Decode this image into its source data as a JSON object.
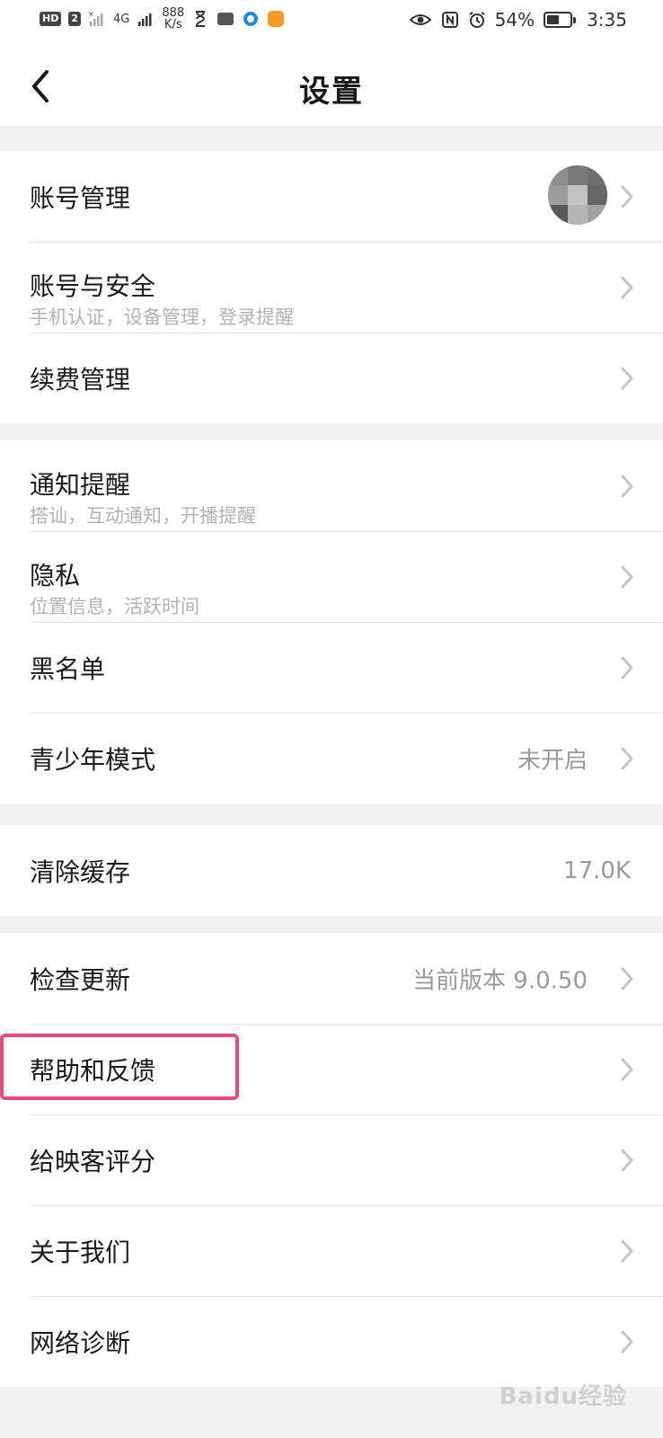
{
  "status_bar": {
    "hd_label": "HD",
    "sim_label": "2",
    "network_label": "4G",
    "speed_value": "888",
    "speed_unit": "K/s",
    "battery_percent": "54%",
    "battery_level": 0.54,
    "time": "3:35"
  },
  "header": {
    "title": "设置",
    "back_icon": "chevron-left-icon"
  },
  "groups": [
    {
      "rows": [
        {
          "title": "账号管理",
          "has_avatar": true
        },
        {
          "title": "账号与安全",
          "subtitle": "手机认证，设备管理，登录提醒"
        },
        {
          "title": "续费管理"
        }
      ]
    },
    {
      "rows": [
        {
          "title": "通知提醒",
          "subtitle": "搭讪，互动通知，开播提醒"
        },
        {
          "title": "隐私",
          "subtitle": "位置信息，活跃时间"
        },
        {
          "title": "黑名单"
        },
        {
          "title": "青少年模式",
          "value": "未开启"
        }
      ]
    },
    {
      "rows": [
        {
          "title": "清除缓存",
          "value": "17.0K"
        }
      ]
    },
    {
      "rows": [
        {
          "title": "检查更新",
          "value": "当前版本 9.0.50"
        },
        {
          "title": "帮助和反馈"
        },
        {
          "title": "给映客评分"
        },
        {
          "title": "关于我们"
        },
        {
          "title": "网络诊断"
        }
      ]
    }
  ],
  "colors": {
    "highlight": "#e84a7f",
    "separator_bg": "#f2f2f2",
    "secondary_text": "#9a9a9a"
  },
  "watermark": "Baidu经验"
}
